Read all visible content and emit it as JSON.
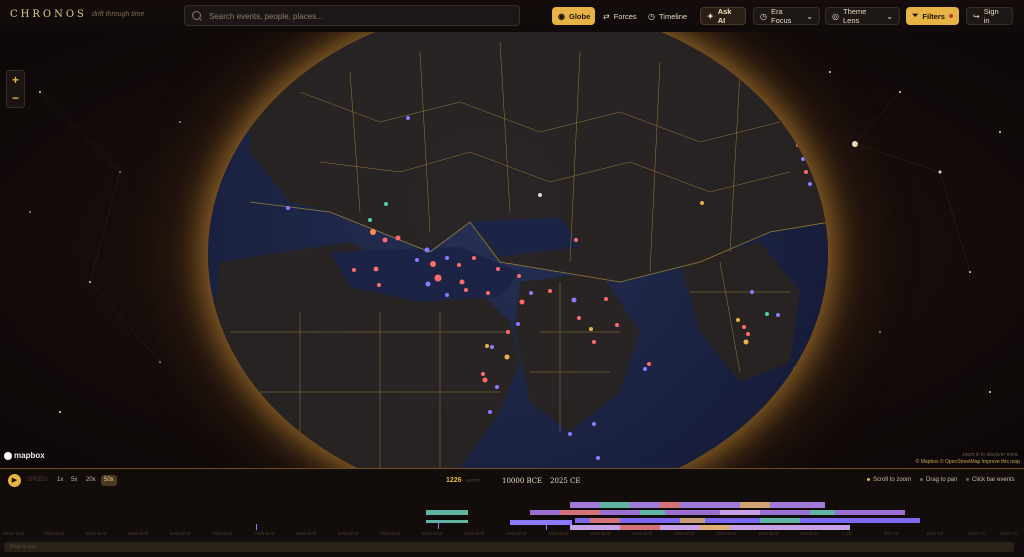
{
  "app": {
    "name": "CHRONOS",
    "tagline": "drift through time"
  },
  "search": {
    "placeholder": "Search events, people, places..."
  },
  "views": [
    {
      "label": "Globe",
      "icon": "globe-icon",
      "active": true
    },
    {
      "label": "Forces",
      "icon": "forces-icon",
      "active": false
    },
    {
      "label": "Timeline",
      "icon": "clock-icon",
      "active": false
    }
  ],
  "toolbar": {
    "ask_ai": "Ask AI",
    "era_focus": "Era Focus",
    "theme_lens": "Theme Lens",
    "filters": "Filters",
    "sign_in": "Sign in"
  },
  "map": {
    "zoom_in": "+",
    "zoom_out": "−",
    "logo": "mapbox",
    "hint": "zoom in to discover more",
    "attribution": "© Mapbox © OpenStreetMap  Improve this map"
  },
  "timeline": {
    "speed_label": "SPEED",
    "speeds": [
      "1x",
      "5x",
      "20x",
      "50x"
    ],
    "active_speed": "50x",
    "event_count": "1226",
    "event_count_label": "events",
    "range_start": "10000 BCE",
    "range_end": "2025 CE",
    "hints": [
      "Scroll to zoom",
      "Drag to pan",
      "Click bar events"
    ],
    "ticks": [
      "10000 BCE",
      "9500 BCE",
      "9000 BCE",
      "8500 BCE",
      "8000 BCE",
      "7500 BCE",
      "7000 BCE",
      "6500 BCE",
      "6000 BCE",
      "5500 BCE",
      "5000 BCE",
      "4500 BCE",
      "4000 BCE",
      "3500 BCE",
      "3000 BCE",
      "2500 BCE",
      "2000 BCE",
      "1500 BCE",
      "1000 BCE",
      "500 BCE",
      "1 CE",
      "500 CE",
      "1000 CE",
      "1500 CE",
      "2000 CE"
    ],
    "scrubber_label": "Drag to pan"
  },
  "colors": {
    "accent": "#e7b344",
    "ocean": "#1a2140",
    "borders": "#c9a23c"
  }
}
